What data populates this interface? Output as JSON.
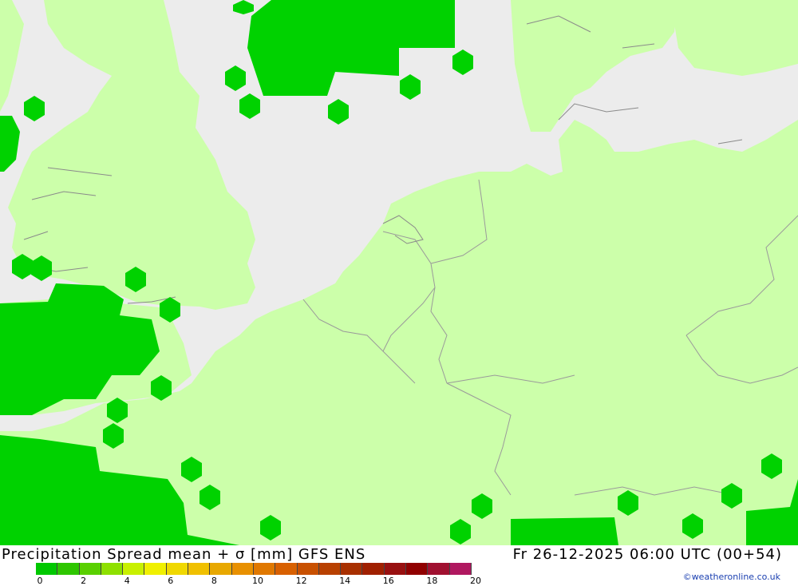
{
  "map": {
    "colors": {
      "sea": "#ececec",
      "land": "#ccffaa",
      "precip": "#00d200",
      "border": "#9a9a9a"
    },
    "region": "North Sea, British Isles and Central Europe"
  },
  "footer": {
    "title": "Precipitation Spread mean + σ [mm] GFS ENS",
    "datetime": "Fr 26-12-2025 06:00 UTC (00+54)",
    "credit": "©weatheronline.co.uk"
  },
  "legend": {
    "colors": [
      "#00c800",
      "#2ec600",
      "#5ad000",
      "#8ee000",
      "#c8f000",
      "#f0f000",
      "#f0d800",
      "#f0c000",
      "#e8a800",
      "#e89000",
      "#e07800",
      "#d86000",
      "#c85000",
      "#b84000",
      "#a83000",
      "#a02000",
      "#981010",
      "#900000",
      "#a01030",
      "#b01860"
    ],
    "ticks": [
      "0",
      "2",
      "4",
      "6",
      "8",
      "10",
      "12",
      "14",
      "16",
      "18",
      "20"
    ]
  }
}
